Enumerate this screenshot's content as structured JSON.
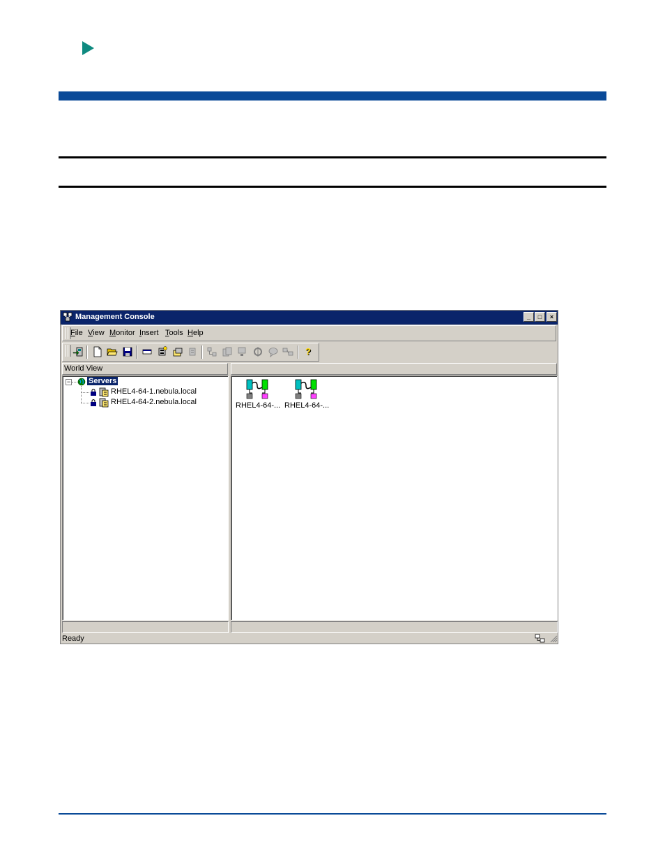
{
  "window": {
    "title": "Management Console",
    "controls": [
      "_",
      "□",
      "×"
    ]
  },
  "menu": {
    "items": [
      {
        "label": "File",
        "key": "F",
        "rest": "ile"
      },
      {
        "label": "View",
        "key": "V",
        "rest": "iew"
      },
      {
        "label": "Monitor",
        "key": "M",
        "rest": "onitor"
      },
      {
        "label": "Insert",
        "key": "I",
        "rest": "nsert"
      },
      {
        "label": "Tools",
        "key": "T",
        "rest": "ools"
      },
      {
        "label": "Help",
        "key": "H",
        "rest": "elp"
      }
    ]
  },
  "left_pane": {
    "header": "World View",
    "tree": {
      "root": "Servers",
      "children": [
        "RHEL4-64-1.nebula.local",
        "RHEL4-64-2.nebula.local"
      ]
    }
  },
  "right_pane": {
    "header": "",
    "icons": [
      "RHEL4-64-...",
      "RHEL4-64-..."
    ]
  },
  "status": {
    "text": "Ready"
  },
  "colors": {
    "title_bar": "#0a246a",
    "doc_accent": "#0a4a98",
    "arrow": "#0f8a80"
  }
}
